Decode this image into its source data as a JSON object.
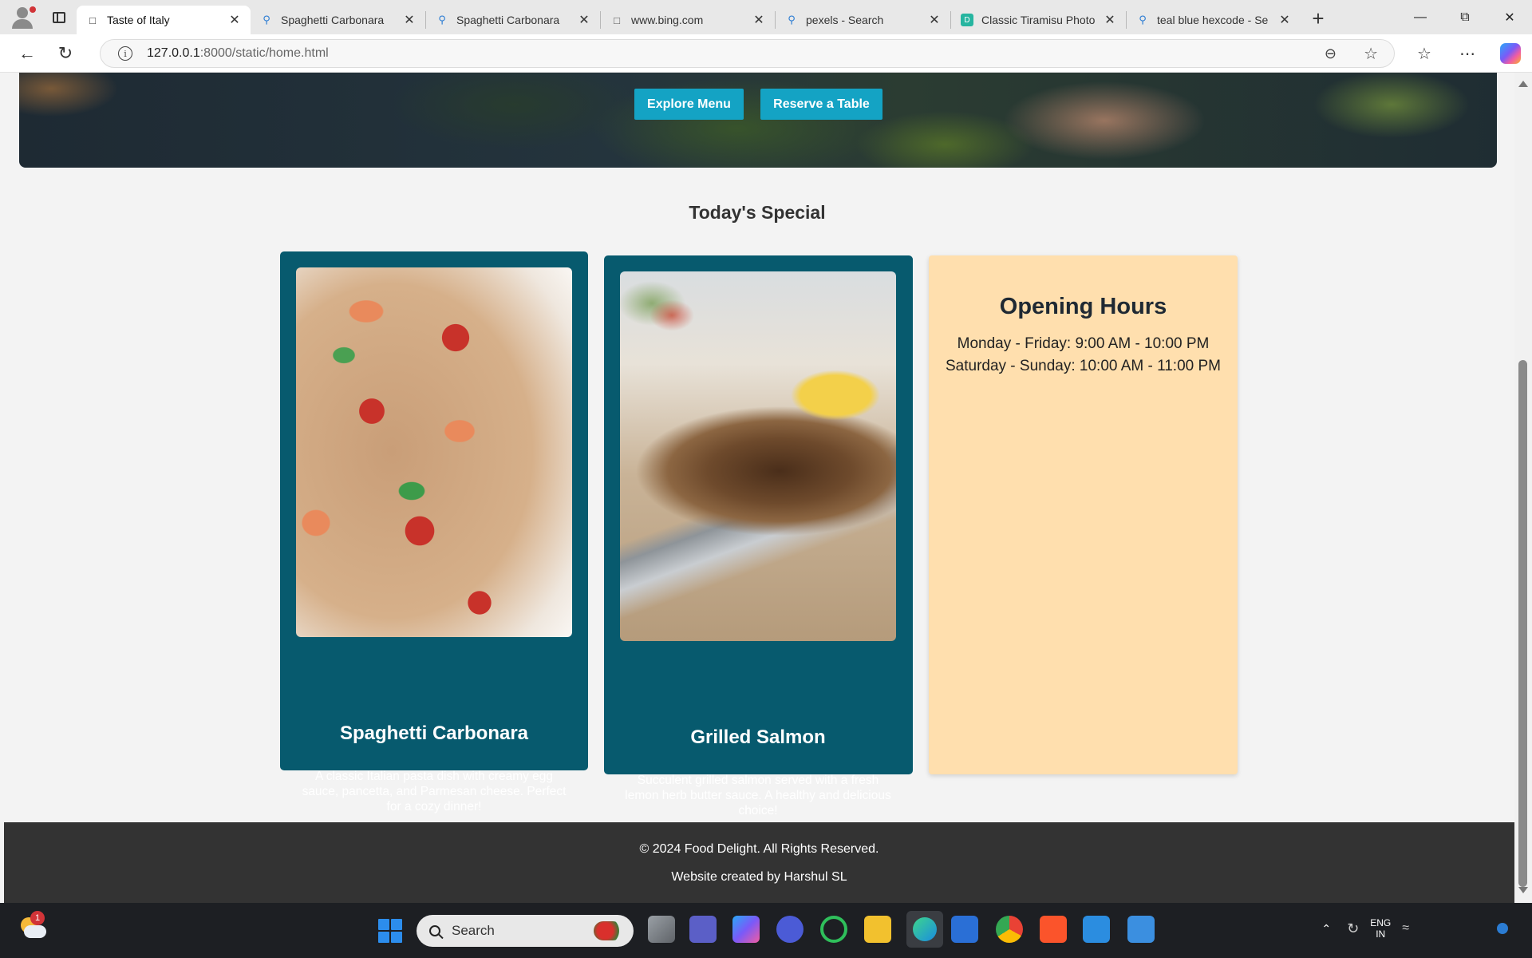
{
  "browser": {
    "tabs": [
      {
        "title": "Taste of Italy",
        "icon": "page-icon",
        "active": true
      },
      {
        "title": "Spaghetti Carbonara",
        "icon": "search-icon"
      },
      {
        "title": "Spaghetti Carbonara",
        "icon": "search-icon"
      },
      {
        "title": "www.bing.com",
        "icon": "page-icon"
      },
      {
        "title": "pexels - Search",
        "icon": "search-icon"
      },
      {
        "title": "Classic Tiramisu Photo",
        "icon": "site-icon"
      },
      {
        "title": "teal blue hexcode - Se",
        "icon": "search-icon"
      }
    ],
    "url_host": "127.0.0.1",
    "url_rest": ":8000/static/home.html"
  },
  "hero": {
    "explore_label": "Explore Menu",
    "reserve_label": "Reserve a Table",
    "button_color": "#14a3c4"
  },
  "specials": {
    "title": "Today's Special",
    "card_color": "#075a6e",
    "items": [
      {
        "name": "Spaghetti Carbonara",
        "description": "A classic Italian pasta dish with creamy egg sauce, pancetta, and Parmesan cheese. Perfect for a cozy dinner!"
      },
      {
        "name": "Grilled Salmon",
        "description": "Succulent grilled salmon served with a fresh lemon herb butter sauce. A healthy and delicious choice!"
      }
    ]
  },
  "hours": {
    "title": "Opening Hours",
    "weekday": "Monday - Friday: 9:00 AM - 10:00 PM",
    "weekend": "Saturday - Sunday: 10:00 AM - 11:00 PM",
    "background": "#ffdfae"
  },
  "footer": {
    "copyright": "© 2024 Food Delight. All Rights Reserved.",
    "credit": "Website created by Harshul SL"
  },
  "taskbar": {
    "weather_badge": "1",
    "search_label": "Search",
    "lang_line1": "ENG",
    "lang_line2": "IN"
  }
}
